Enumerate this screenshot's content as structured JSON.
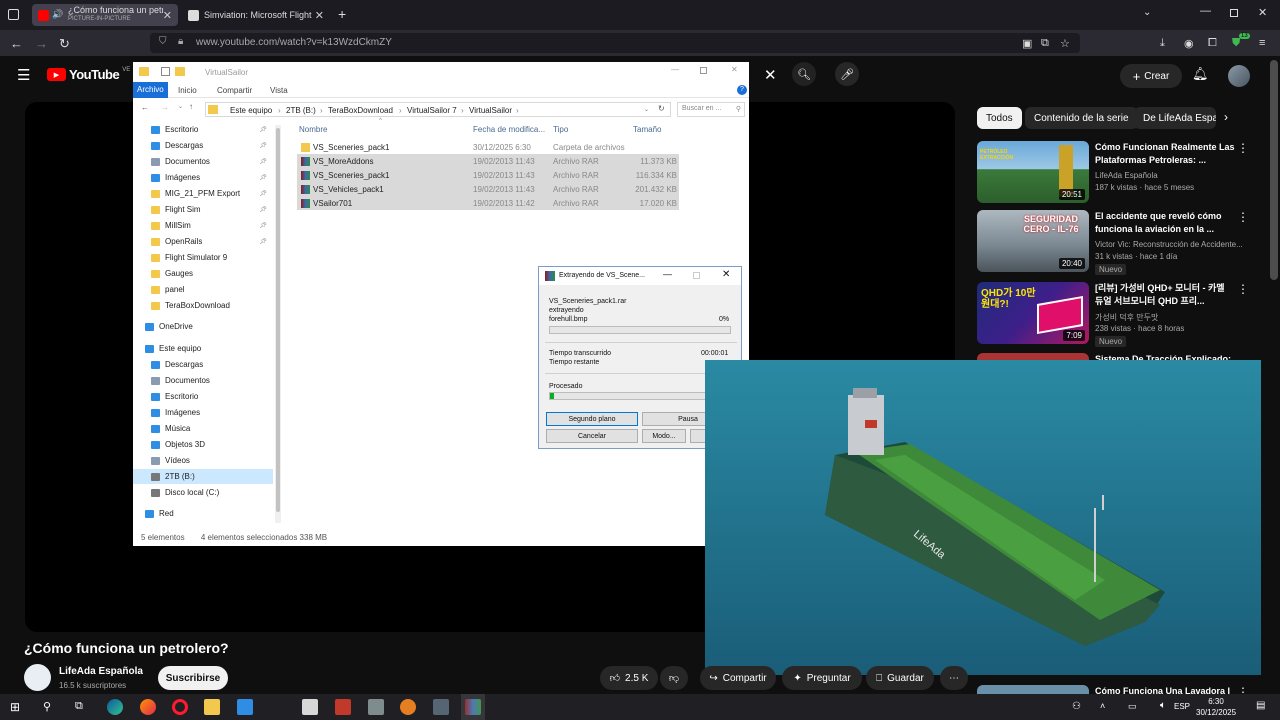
{
  "browser": {
    "tabs": [
      {
        "label": "¿Cómo funciona un petrolero?",
        "sublabel": "PICTURE-IN-PICTURE",
        "active": true
      },
      {
        "label": "Simviation: Microsoft Flight Sim",
        "active": false
      }
    ],
    "url": "www.youtube.com/watch?v=k13WzdCkmZY",
    "extension_badge": "13"
  },
  "youtube": {
    "logo": "YouTube",
    "country": "VE",
    "create_label": "Crear",
    "chips": [
      "Todos",
      "Contenido de la serie",
      "De LifeAda Espa"
    ],
    "video_title": "¿Cómo funciona un petrolero?",
    "channel_name": "LifeAda Española",
    "subscribers": "16.5 k suscriptores",
    "subscribe_label": "Suscribirse",
    "likes": "2.5 K",
    "share_label": "Compartir",
    "ask_label": "Preguntar",
    "save_label": "Guardar",
    "recommendations": [
      {
        "title": "Cómo Funcionan Realmente Las Plataformas Petroleras: ...",
        "channel": "LifeAda Española",
        "meta": "187 k vistas · hace 5 meses",
        "duration": "20:51",
        "thumb_text": "PETRÓLEO EXTRACCIÓN",
        "badge": ""
      },
      {
        "title": "El accidente que reveló cómo funciona la aviación en la ...",
        "channel": "Victor Vic: Reconstrucción de Accidente...",
        "meta": "31 k vistas · hace 1 día",
        "duration": "20:40",
        "thumb_text": "SEGURIDAD CERO - IL-76",
        "badge": "Nuevo"
      },
      {
        "title": "[리뷰] 가성비 QHD+ 모니터 - 카멜 듀얼 서브모니터 QHD 프리...",
        "channel": "가성비 덕후 만두맛",
        "meta": "238 vistas · hace 8 horas",
        "duration": "7:09",
        "thumb_text": "QHD가 10만원대?!",
        "badge": "Nuevo"
      },
      {
        "title": "Sistema De Tracción Explicado:",
        "channel": "",
        "meta": "",
        "duration": "",
        "thumb_text": "",
        "badge": ""
      },
      {
        "title": "Cómo Funciona Una Lavadora I",
        "channel": "",
        "meta": "",
        "duration": "",
        "thumb_text": "",
        "badge": ""
      }
    ]
  },
  "explorer": {
    "window_title": "VirtualSailor",
    "ribbon_tabs": [
      "Archivo",
      "Inicio",
      "Compartir",
      "Vista"
    ],
    "breadcrumb": [
      "Este equipo",
      "2TB (B:)",
      "TeraBoxDownload",
      "VirtualSailor 7",
      "VirtualSailor"
    ],
    "search_placeholder": "Buscar en ...",
    "nav_items": [
      {
        "label": "Escritorio",
        "color": "#2f8de4",
        "pinned": true
      },
      {
        "label": "Descargas",
        "color": "#2f8de4",
        "pinned": true
      },
      {
        "label": "Documentos",
        "color": "#8a9bb0",
        "pinned": true
      },
      {
        "label": "Imágenes",
        "color": "#2f8de4",
        "pinned": true
      },
      {
        "label": "MIG_21_PFM Export",
        "color": "#f2c94c",
        "pinned": true
      },
      {
        "label": "Flight Sim",
        "color": "#f2c94c",
        "pinned": true
      },
      {
        "label": "MillSim",
        "color": "#f2c94c",
        "pinned": true
      },
      {
        "label": "OpenRails",
        "color": "#f2c94c",
        "pinned": true
      },
      {
        "label": "Flight Simulator 9",
        "color": "#f2c94c",
        "pinned": false
      },
      {
        "label": "Gauges",
        "color": "#f2c94c",
        "pinned": false
      },
      {
        "label": "panel",
        "color": "#f2c94c",
        "pinned": false
      },
      {
        "label": "TeraBoxDownload",
        "color": "#f2c94c",
        "pinned": false
      },
      {
        "label": "OneDrive",
        "color": "#2f8de4",
        "pinned": false
      },
      {
        "label": "Este equipo",
        "color": "#2f8de4",
        "pinned": false
      },
      {
        "label": "Descargas",
        "color": "#2f8de4",
        "pinned": false
      },
      {
        "label": "Documentos",
        "color": "#8a9bb0",
        "pinned": false
      },
      {
        "label": "Escritorio",
        "color": "#2f8de4",
        "pinned": false
      },
      {
        "label": "Imágenes",
        "color": "#2f8de4",
        "pinned": false
      },
      {
        "label": "Música",
        "color": "#2f8de4",
        "pinned": false
      },
      {
        "label": "Objetos 3D",
        "color": "#2f8de4",
        "pinned": false
      },
      {
        "label": "Vídeos",
        "color": "#8a9bb0",
        "pinned": false
      },
      {
        "label": "2TB (B:)",
        "color": "#777777",
        "pinned": false
      },
      {
        "label": "Disco local (C:)",
        "color": "#777777",
        "pinned": false
      },
      {
        "label": "Red",
        "color": "#2f8de4",
        "pinned": false
      }
    ],
    "columns": [
      "Nombre",
      "Fecha de modifica...",
      "Tipo",
      "Tamaño"
    ],
    "files": [
      {
        "name": "VS_Sceneries_pack1",
        "date": "30/12/2025 6:30",
        "type": "Carpeta de archivos",
        "size": "",
        "kind": "folder",
        "selected": false
      },
      {
        "name": "VS_MoreAddons",
        "date": "19/02/2013 11:43",
        "type": "Archivo RAR",
        "size": "11.373 KB",
        "kind": "rar",
        "selected": true
      },
      {
        "name": "VS_Sceneries_pack1",
        "date": "19/02/2013 11:43",
        "type": "Archivo RAR",
        "size": "116.334 KB",
        "kind": "rar",
        "selected": true
      },
      {
        "name": "VS_Vehicles_pack1",
        "date": "19/02/2013 11:43",
        "type": "Archivo RAR",
        "size": "201.432 KB",
        "kind": "rar",
        "selected": true
      },
      {
        "name": "VSailor701",
        "date": "19/02/2013 11:42",
        "type": "Archivo RAR",
        "size": "17.020 KB",
        "kind": "rar",
        "selected": true
      }
    ],
    "status": {
      "count": "5 elementos",
      "selection": "4 elementos seleccionados  338 MB"
    }
  },
  "dialog": {
    "title": "Extrayendo de VS_Scene...",
    "archive": "VS_Sceneries_pack1.rar",
    "action": "extrayendo",
    "current_file": "forehull.bmp",
    "file_percent": "0%",
    "file_progress": 0,
    "elapsed_label": "Tiempo transcurrido",
    "elapsed_value": "00:00:01",
    "remaining_label": "Tiempo restante",
    "processed_label": "Procesado",
    "processed_progress": 0.02,
    "buttons": [
      "Segundo plano",
      "Pausa",
      "Cancelar",
      "Modo...",
      "A"
    ]
  },
  "taskbar": {
    "time": "6:30",
    "date": "30/12/2025",
    "language": "ESP"
  },
  "colors": {
    "youtube_red": "#ff0000",
    "explorer_selected": "#d9d9d9",
    "ribbon_active": "#1a6ed8",
    "progress_green": "#06b025"
  }
}
